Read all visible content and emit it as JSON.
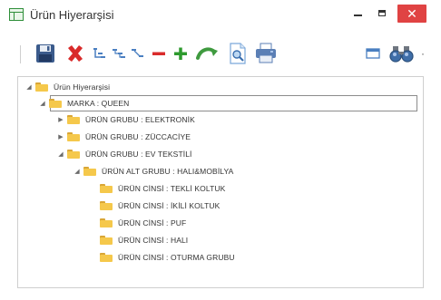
{
  "window": {
    "title": "Ürün Hiyerarşisi",
    "close_label": "✕"
  },
  "toolbar": {
    "icons": [
      "save-icon",
      "delete-icon",
      "indent-left-icon",
      "indent-tree-icon",
      "outdent-icon",
      "remove-icon",
      "add-icon",
      "refresh-icon",
      "preview-icon",
      "print-icon",
      "collapse-window-icon",
      "find-icon"
    ],
    "find_dropdown_label": "·"
  },
  "tree": {
    "root": "Ürün Hiyerarşisi",
    "brand": "MARKA : QUEEN",
    "groups": [
      "ÜRÜN GRUBU : ELEKTRONİK",
      "ÜRÜN GRUBU : ZÜCCACİYE",
      "ÜRÜN GRUBU : EV TEKSTİLİ"
    ],
    "subgroup": "ÜRÜN ALT GRUBU : HALI&MOBİLYA",
    "types": [
      "ÜRÜN CİNSİ : TEKLİ KOLTUK",
      "ÜRÜN CİNSİ : İKİLİ KOLTUK",
      "ÜRÜN CİNSİ : PUF",
      "ÜRÜN CİNSİ : HALI",
      "ÜRÜN CİNSİ : OTURMA GRUBU"
    ],
    "expanded_glyph": "◢",
    "collapsed_glyph": "▶"
  },
  "colors": {
    "close": "#e04343",
    "folder": "#f5c84b",
    "save": "#3b5b8c",
    "delete": "#d92b2b",
    "add": "#2e9a2e",
    "remove": "#d92b2b",
    "refresh": "#3f9a3f"
  }
}
